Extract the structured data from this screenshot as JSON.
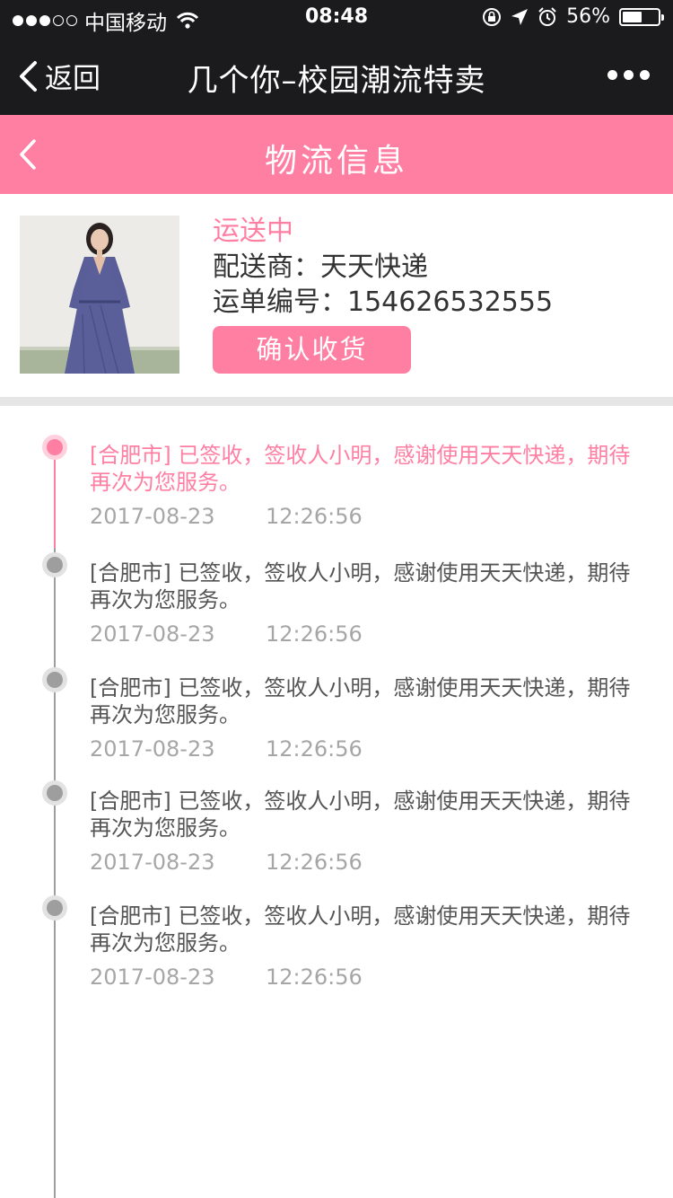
{
  "status_bar": {
    "carrier": "中国移动",
    "time": "08:48",
    "battery_percent": "56%",
    "battery_level": 0.56
  },
  "nav": {
    "back_label": "返回",
    "title": "几个你–校园潮流特卖",
    "more_icon": "more-dots-icon"
  },
  "header": {
    "title": "物流信息",
    "back_icon": "chevron-left-icon"
  },
  "order": {
    "status": "运送中",
    "carrier_label": "配送商：",
    "carrier_name": "天天快递",
    "tracking_label": "运单编号：",
    "tracking_number": "154626532555",
    "confirm_button": "确认收货"
  },
  "timeline": [
    {
      "message": "[合肥市] 已签收，签收人小明，感谢使用天天快递，期待再次为您服务。",
      "date": "2017-08-23",
      "time": "12:26:56"
    },
    {
      "message": "[合肥市] 已签收，签收人小明，感谢使用天天快递，期待再次为您服务。",
      "date": "2017-08-23",
      "time": "12:26:56"
    },
    {
      "message": "[合肥市] 已签收，签收人小明，感谢使用天天快递，期待再次为您服务。",
      "date": "2017-08-23",
      "time": "12:26:56"
    },
    {
      "message": "[合肥市] 已签收，签收人小明，感谢使用天天快递，期待再次为您服务。",
      "date": "2017-08-23",
      "time": "12:26:56"
    },
    {
      "message": "[合肥市] 已签收，签收人小明，感谢使用天天快递，期待再次为您服务。",
      "date": "2017-08-23",
      "time": "12:26:56"
    }
  ],
  "colors": {
    "accent": "#ff7fa3",
    "dark_bar": "#1b1b1d",
    "timeline_gray": "#9e9e9e"
  }
}
